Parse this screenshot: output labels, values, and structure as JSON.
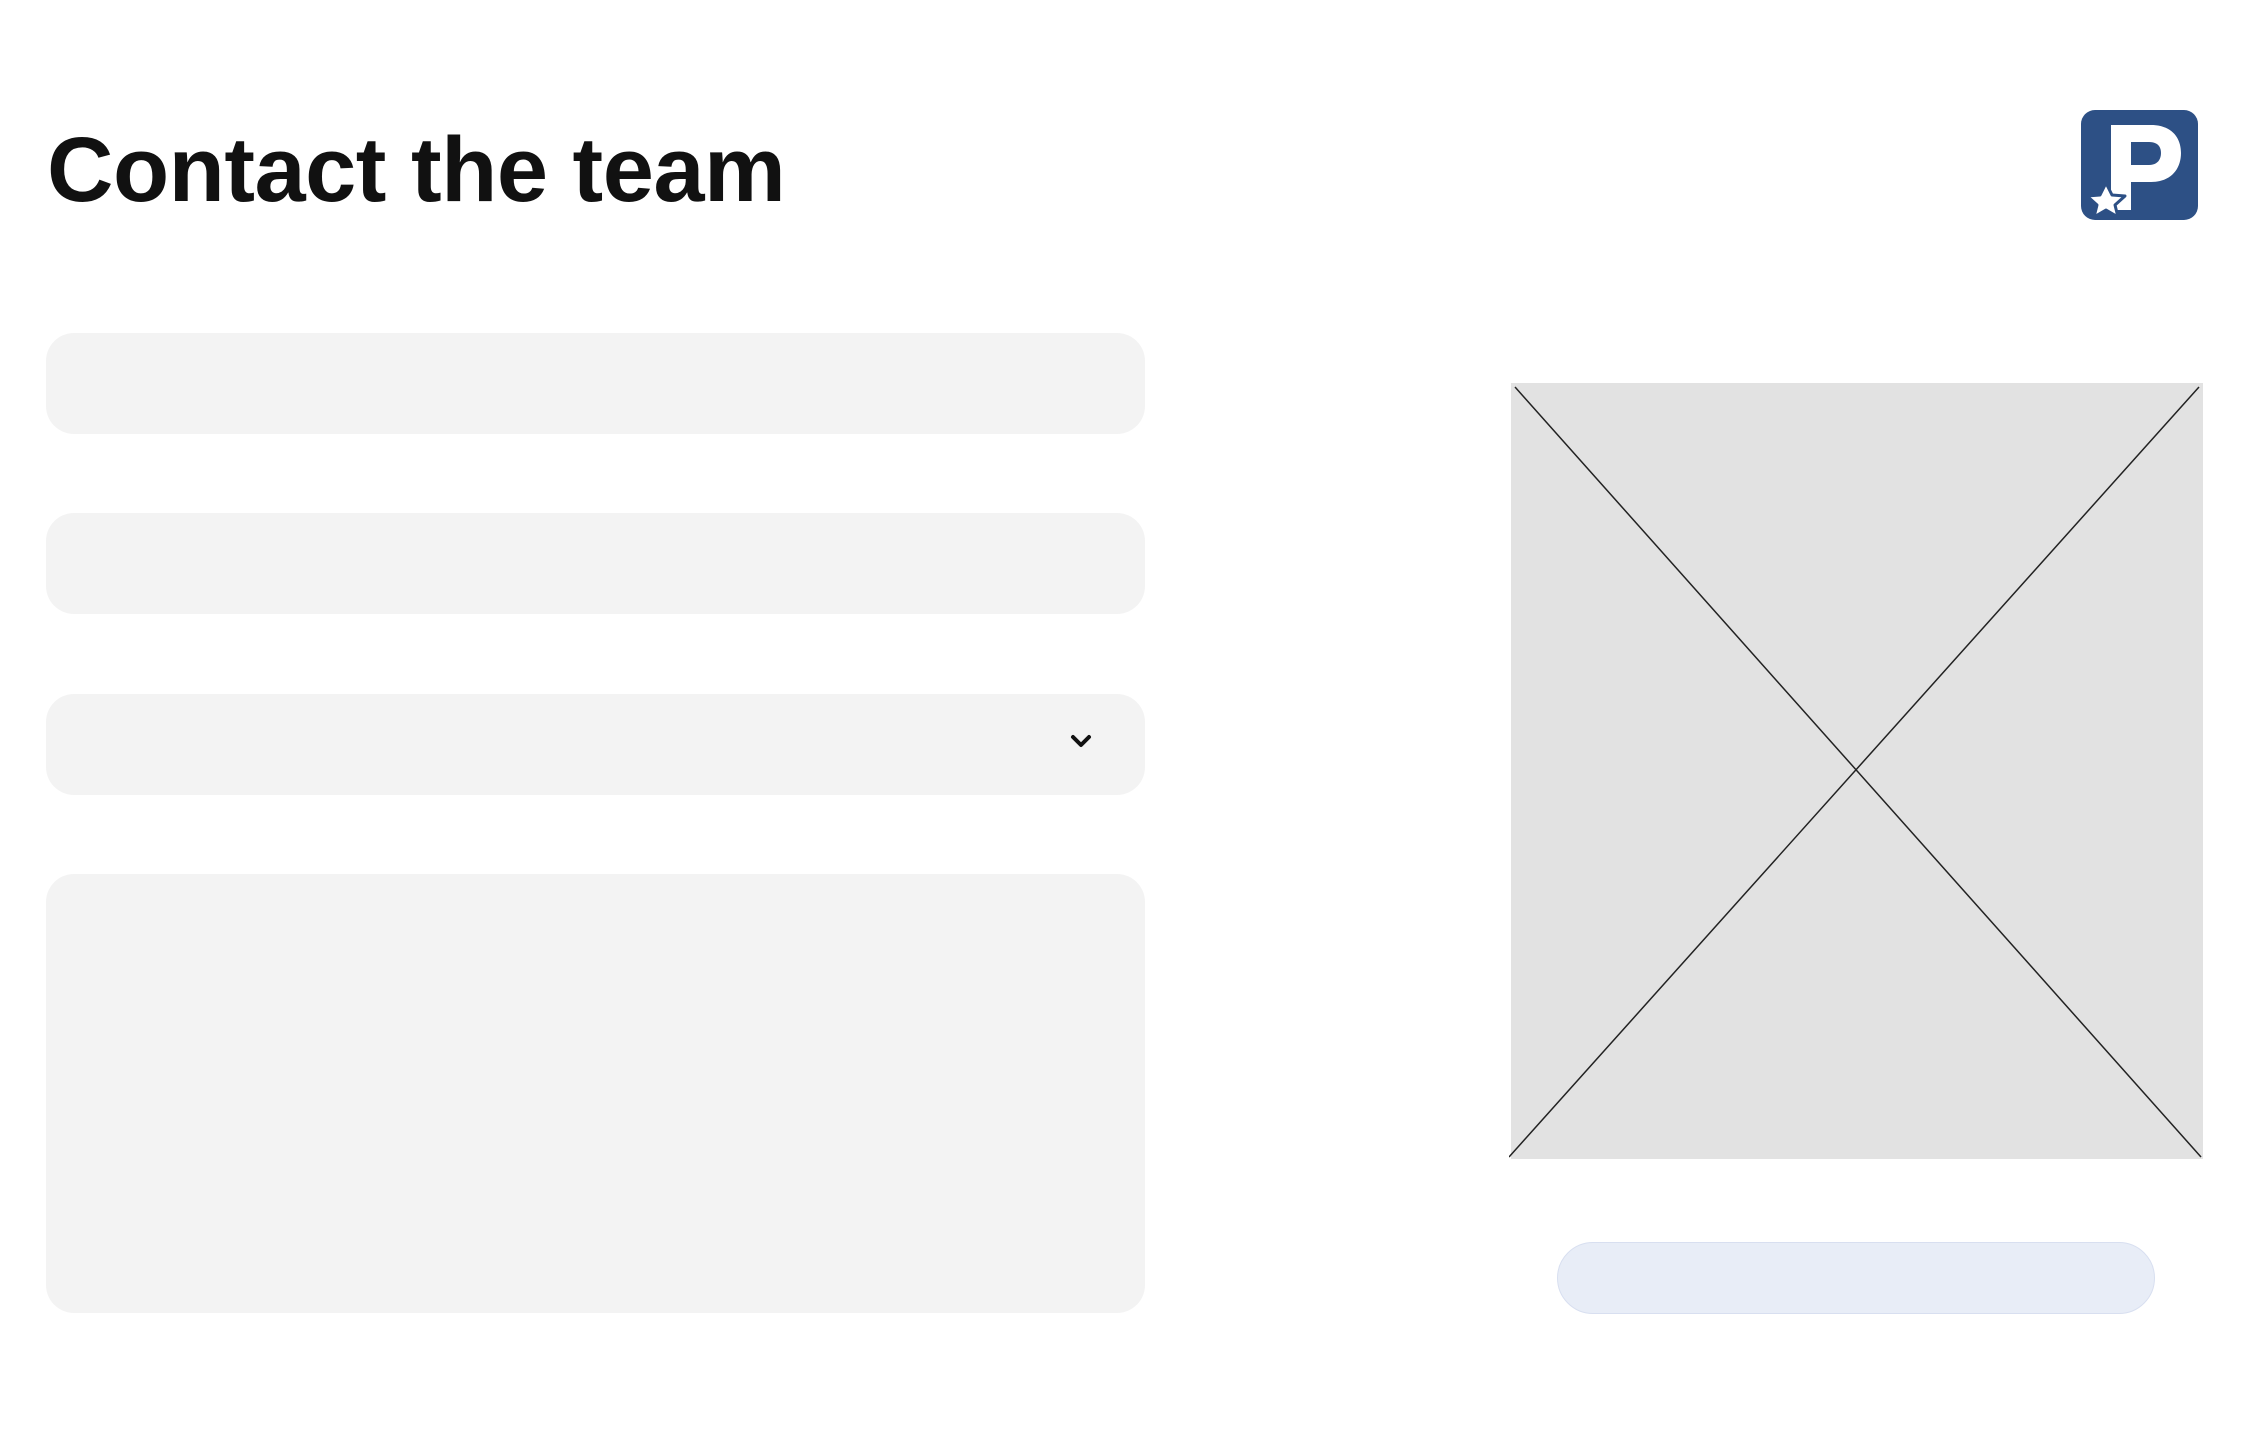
{
  "page": {
    "title": "Contact the team"
  },
  "form": {
    "fields": [
      {
        "value": "",
        "placeholder": ""
      },
      {
        "value": "",
        "placeholder": ""
      },
      {
        "selected": "",
        "options": []
      },
      {
        "value": "",
        "placeholder": ""
      }
    ],
    "submit_label": ""
  },
  "icons": {
    "logo": "parking-star-logo",
    "select": "chevron-down-icon",
    "image": "image-placeholder"
  },
  "colors": {
    "logo_bg": "#2d5085",
    "field_bg": "#f3f3f3",
    "image_bg": "#e2e2e2",
    "button_bg": "#e8edf7",
    "title": "#111111"
  }
}
